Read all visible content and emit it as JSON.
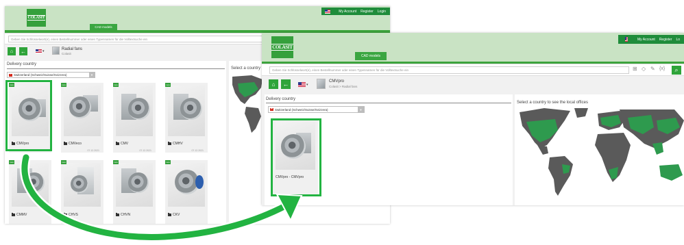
{
  "back_window": {
    "nav": {
      "my_account": "My Account",
      "register": "Register",
      "login": "Login"
    },
    "logo_text": "COLASIT",
    "cad_tab": "CAD models",
    "search_placeholder": "Geben Sie Schlüsselwort(e), einen Bestellnummer oder einen Typennamen für die Volltextsuche ein",
    "breadcrumb": {
      "title": "Radial fans",
      "sub": "Colasit"
    },
    "delivery_country_label": "Delivery country",
    "country_value": "Switzerland (Schweiz/Suisse/Svizzera)",
    "map_label": "Select a country t",
    "products": [
      {
        "name": "CMVpro",
        "date": ""
      },
      {
        "name": "CMVeco",
        "date": "07.12.2021"
      },
      {
        "name": "CMV",
        "date": "07.12.2021"
      },
      {
        "name": "CMHV",
        "date": "07.12.2021"
      },
      {
        "name": "CMMV",
        "date": ""
      },
      {
        "name": "CHVS",
        "date": ""
      },
      {
        "name": "CHVN",
        "date": ""
      },
      {
        "name": "CKV",
        "date": ""
      }
    ]
  },
  "front_window": {
    "nav": {
      "my_account": "My Account",
      "register": "Register",
      "login": "Lo"
    },
    "logo_text": "COLASIT",
    "cad_tab": "CAD models",
    "search_placeholder": "Geben Sie Schlüsselwort(e), einen Bestellnummer oder einen Typennamen für die Volltextsuche ein",
    "breadcrumb": {
      "title": "CMVpro",
      "sub": "Colasit  >  Radial fans"
    },
    "delivery_country_label": "Delivery country",
    "country_value": "Switzerland (Schweiz/Suisse/Svizzera)",
    "map_label": "Select a country to see the local offices",
    "product": {
      "name": "CMVpro - CMVpro"
    },
    "toolbar_icons": [
      "hierarchy-icon",
      "cube-icon",
      "pencil-icon",
      "variables-icon",
      "search-icon"
    ]
  },
  "colors": {
    "brand_green": "#35a03c",
    "highlight_green": "#22b341",
    "map_land": "#5a5a5a",
    "map_office": "#2e9a4e"
  }
}
